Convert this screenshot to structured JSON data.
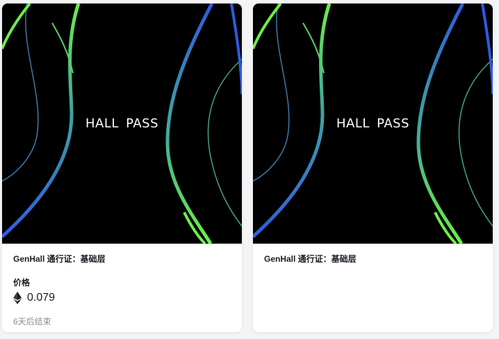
{
  "cards": [
    {
      "art_title": "HALL  PASS",
      "name": "GenHall 通行证：基础层",
      "price_label": "价格",
      "price_value": "0.079",
      "currency_icon": "ethereum-icon",
      "ends_text": "6天后结束"
    },
    {
      "art_title": "HALL  PASS",
      "name": "GenHall 通行证：基础层"
    }
  ],
  "colors": {
    "green": "#6cf047",
    "blue": "#2f5be0",
    "teal": "#46a6a8",
    "text": "#1b1d24",
    "muted": "#8a8d96"
  }
}
